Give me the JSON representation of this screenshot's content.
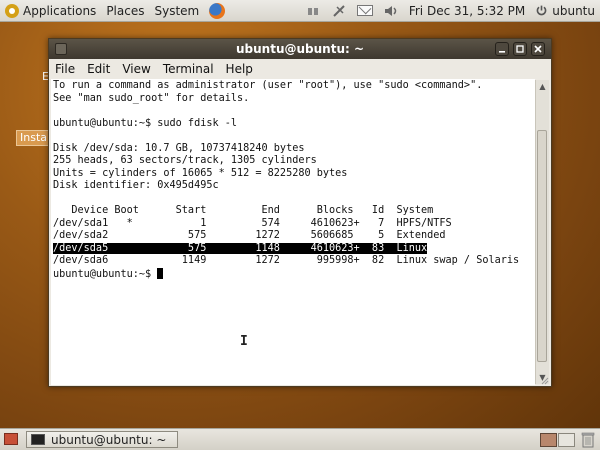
{
  "top_panel": {
    "menus": [
      "Applications",
      "Places",
      "System"
    ],
    "clock": "Fri Dec 31,  5:32 PM",
    "user": "ubuntu"
  },
  "desktop": {
    "install_label": "Instal"
  },
  "window": {
    "title": "ubuntu@ubuntu: ~",
    "menus": [
      "File",
      "Edit",
      "View",
      "Terminal",
      "Help"
    ]
  },
  "terminal": {
    "lines": [
      "To run a command as administrator (user \"root\"), use \"sudo <command>\".",
      "See \"man sudo_root\" for details.",
      "",
      "ubuntu@ubuntu:~$ sudo fdisk -l",
      "",
      "Disk /dev/sda: 10.7 GB, 10737418240 bytes",
      "255 heads, 63 sectors/track, 1305 cylinders",
      "Units = cylinders of 16065 * 512 = 8225280 bytes",
      "Disk identifier: 0x495d495c",
      "",
      "   Device Boot      Start         End      Blocks   Id  System",
      "/dev/sda1   *           1         574     4610623+   7  HPFS/NTFS",
      "/dev/sda2             575        1272     5606685    5  Extended",
      "/dev/sda5             575        1148     4610623+  83  Linux",
      "/dev/sda6            1149        1272      995998+  82  Linux swap / Solaris"
    ],
    "prompt": "ubuntu@ubuntu:~$ "
  },
  "bottom_panel": {
    "task_label": "ubuntu@ubuntu: ~"
  }
}
